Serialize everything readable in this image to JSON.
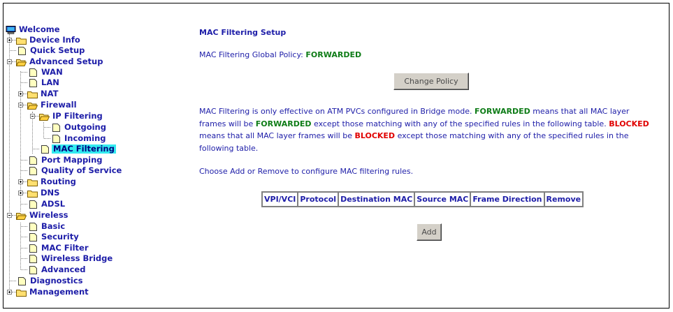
{
  "tree": [
    {
      "label": "Welcome"
    },
    {
      "label": "Device Info"
    },
    {
      "label": "Quick Setup"
    },
    {
      "label": "Advanced Setup"
    },
    {
      "label": "WAN"
    },
    {
      "label": "LAN"
    },
    {
      "label": "NAT"
    },
    {
      "label": "Firewall"
    },
    {
      "label": "IP Filtering"
    },
    {
      "label": "Outgoing"
    },
    {
      "label": "Incoming"
    },
    {
      "label": "MAC Filtering"
    },
    {
      "label": "Port Mapping"
    },
    {
      "label": "Quality of Service"
    },
    {
      "label": "Routing"
    },
    {
      "label": "DNS"
    },
    {
      "label": "ADSL"
    },
    {
      "label": "Wireless"
    },
    {
      "label": "Basic"
    },
    {
      "label": "Security"
    },
    {
      "label": "MAC Filter"
    },
    {
      "label": "Wireless Bridge"
    },
    {
      "label": "Advanced"
    },
    {
      "label": "Diagnostics"
    },
    {
      "label": "Management"
    }
  ],
  "page": {
    "title": "MAC Filtering Setup",
    "policy_label": "MAC Filtering Global Policy: ",
    "policy_value": "FORWARDED",
    "change_policy_button": "Change Policy",
    "desc_1": "MAC Filtering is only effective on ATM PVCs configured in Bridge mode. ",
    "desc_fwd_1": "FORWARDED",
    "desc_2": " means that all MAC layer frames will be ",
    "desc_fwd_2": "FORWARDED",
    "desc_3": " except those matching with any of the specified rules in the following table. ",
    "desc_blk_1": "BLOCKED",
    "desc_4": " means that all MAC layer frames will be ",
    "desc_blk_2": "BLOCKED",
    "desc_5": " except those matching with any of the specified rules in the following table.",
    "choose_text": "Choose Add or Remove to configure MAC filtering rules.",
    "table_headers": [
      "VPI/VCI",
      "Protocol",
      "Destination MAC",
      "Source MAC",
      "Frame Direction",
      "Remove"
    ],
    "add_button": "Add"
  },
  "colors": {
    "link": "#1d1da8",
    "forwarded": "#0e7c17",
    "blocked": "#e00000",
    "selected_bg": "#33eaf0"
  }
}
